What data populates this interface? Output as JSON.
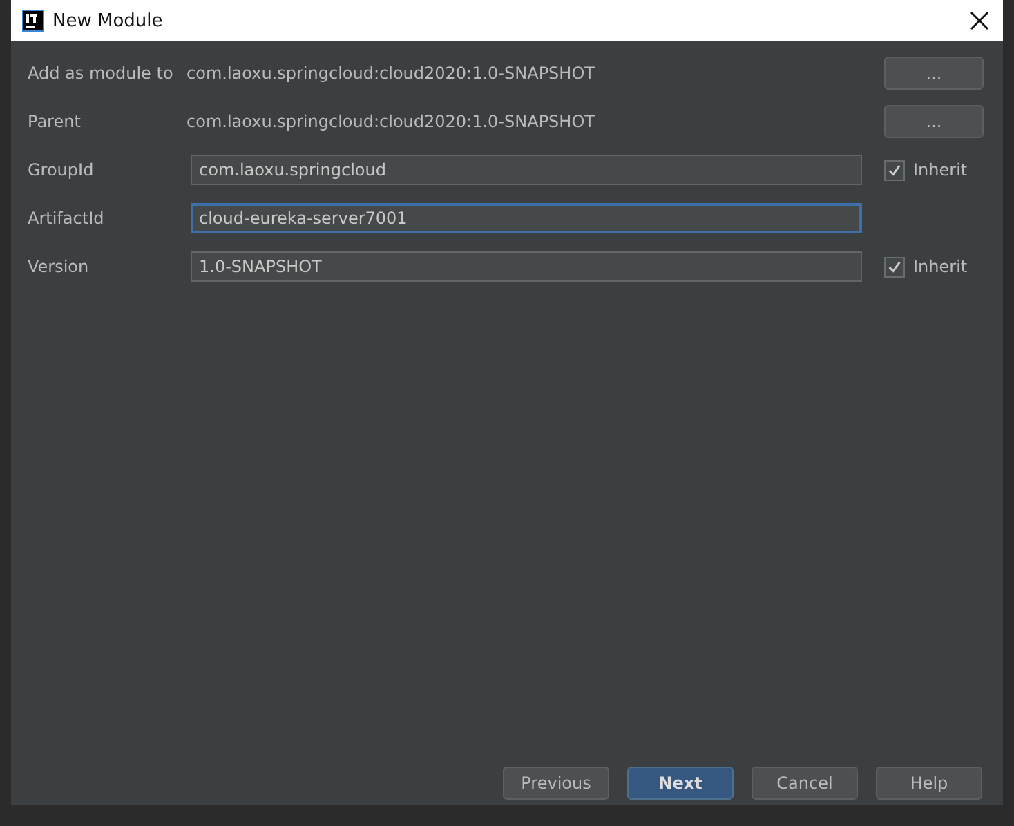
{
  "window": {
    "title": "New Module"
  },
  "rows": [
    {
      "kind": "text",
      "label": "Add as module to",
      "value": "com.laoxu.springcloud:cloud2020:1.0-SNAPSHOT",
      "button": "..."
    },
    {
      "kind": "text",
      "label": "Parent",
      "value": "com.laoxu.springcloud:cloud2020:1.0-SNAPSHOT",
      "button": "..."
    },
    {
      "kind": "field",
      "label": "GroupId",
      "value": "com.laoxu.springcloud",
      "focused": false,
      "inherit": {
        "label": "Inherit",
        "checked": true
      }
    },
    {
      "kind": "field",
      "label": "ArtifactId",
      "value": "cloud-eureka-server7001",
      "focused": true
    },
    {
      "kind": "field",
      "label": "Version",
      "value": "1.0-SNAPSHOT",
      "focused": false,
      "inherit": {
        "label": "Inherit",
        "checked": true
      }
    }
  ],
  "buttons": [
    {
      "label": "Previous",
      "default": false
    },
    {
      "label": "Next",
      "default": true
    },
    {
      "label": "Cancel",
      "default": false
    },
    {
      "label": "Help",
      "default": false
    }
  ]
}
